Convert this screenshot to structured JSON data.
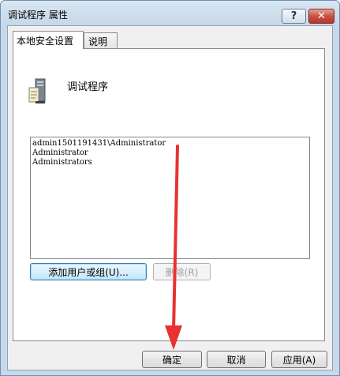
{
  "window": {
    "title": "调试程序 属性"
  },
  "titlebar": {
    "help_glyph": "?",
    "close_glyph": "✕"
  },
  "tabs": [
    {
      "label": "本地安全设置"
    },
    {
      "label": "说明"
    }
  ],
  "policy": {
    "name": "调试程序",
    "icon": "server-policy-icon"
  },
  "accounts": [
    "admin1501191431\\Administrator",
    "Administrator",
    "Administrators"
  ],
  "buttons": {
    "add": "添加用户或组(U)...",
    "remove": "删除(R)",
    "ok": "确定",
    "cancel": "取消",
    "apply": "应用(A)"
  },
  "colors": {
    "annotation_arrow": "#e8322f",
    "title_gradient_top": "#d9e6f2",
    "close_button": "#c75143"
  }
}
